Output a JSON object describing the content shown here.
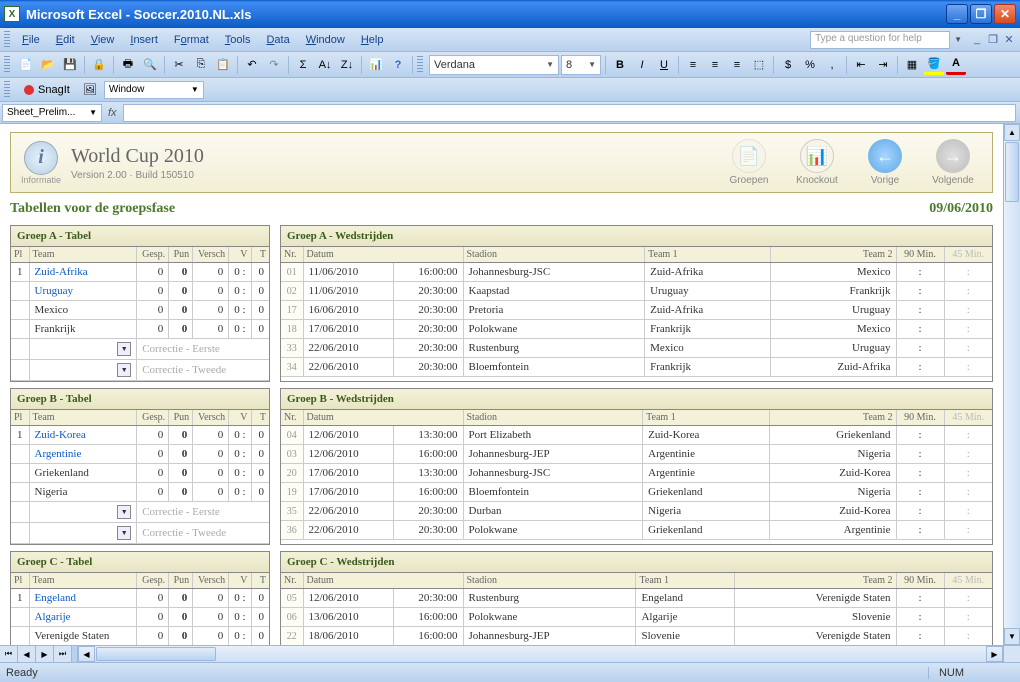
{
  "titlebar": {
    "app": "Microsoft Excel",
    "doc": "Soccer.2010.NL.xls"
  },
  "menu": {
    "file": "File",
    "edit": "Edit",
    "view": "View",
    "insert": "Insert",
    "format": "Format",
    "tools": "Tools",
    "data": "Data",
    "window": "Window",
    "help": "Help",
    "askbox": "Type a question for help"
  },
  "toolbar": {
    "font": "Verdana",
    "size": "8"
  },
  "snagit": {
    "label": "SnagIt",
    "window": "Window"
  },
  "namebox": "Sheet_Prelim...",
  "status": {
    "ready": "Ready",
    "num": "NUM"
  },
  "page": {
    "title": "World Cup 2010",
    "info_label": "Informatie",
    "version": "Version 2.00 · Build 150510",
    "nav": {
      "groepen": "Groepen",
      "knockout": "Knockout",
      "vorige": "Vorige",
      "volgende": "Volgende"
    },
    "subtitle": "Tabellen voor de groepsfase",
    "date": "09/06/2010",
    "table_cols": {
      "pl": "Pl",
      "team": "Team",
      "gesp": "Gesp.",
      "pun": "Pun",
      "versch": "Versch",
      "v": "V",
      "t": "T"
    },
    "match_cols": {
      "nr": "Nr.",
      "datum": "Datum",
      "stadion": "Stadion",
      "team1": "Team 1",
      "team2": "Team 2",
      "m90": "90 Min.",
      "m45": "45 Min."
    },
    "corrections": {
      "eerste": "Correctie - Eerste",
      "tweede": "Correctie - Tweede"
    },
    "groups": [
      {
        "label": "A",
        "tabel_title": "Groep A - Tabel",
        "wed_title": "Groep A - Wedstrijden",
        "standings": [
          {
            "pl": "1",
            "team": "Zuid-Afrika",
            "link": true,
            "gesp": "0",
            "pun": "0",
            "versch": "0",
            "v": "0",
            "t": "0"
          },
          {
            "pl": "",
            "team": "Uruguay",
            "link": true,
            "gesp": "0",
            "pun": "0",
            "versch": "0",
            "v": "0",
            "t": "0"
          },
          {
            "pl": "",
            "team": "Mexico",
            "link": false,
            "gesp": "0",
            "pun": "0",
            "versch": "0",
            "v": "0",
            "t": "0"
          },
          {
            "pl": "",
            "team": "Frankrijk",
            "link": false,
            "gesp": "0",
            "pun": "0",
            "versch": "0",
            "v": "0",
            "t": "0"
          }
        ],
        "matches": [
          {
            "nr": "01",
            "datum": "11/06/2010",
            "tijd": "16:00:00",
            "stadion": "Johannesburg-JSC",
            "team1": "Zuid-Afrika",
            "team2": "Mexico",
            "m90": ":",
            "m45": ":"
          },
          {
            "nr": "02",
            "datum": "11/06/2010",
            "tijd": "20:30:00",
            "stadion": "Kaapstad",
            "team1": "Uruguay",
            "team2": "Frankrijk",
            "m90": ":",
            "m45": ":"
          },
          {
            "nr": "17",
            "datum": "16/06/2010",
            "tijd": "20:30:00",
            "stadion": "Pretoria",
            "team1": "Zuid-Afrika",
            "team2": "Uruguay",
            "m90": ":",
            "m45": ":"
          },
          {
            "nr": "18",
            "datum": "17/06/2010",
            "tijd": "20:30:00",
            "stadion": "Polokwane",
            "team1": "Frankrijk",
            "team2": "Mexico",
            "m90": ":",
            "m45": ":"
          },
          {
            "nr": "33",
            "datum": "22/06/2010",
            "tijd": "20:30:00",
            "stadion": "Rustenburg",
            "team1": "Mexico",
            "team2": "Uruguay",
            "m90": ":",
            "m45": ":"
          },
          {
            "nr": "34",
            "datum": "22/06/2010",
            "tijd": "20:30:00",
            "stadion": "Bloemfontein",
            "team1": "Frankrijk",
            "team2": "Zuid-Afrika",
            "m90": ":",
            "m45": ":"
          }
        ]
      },
      {
        "label": "B",
        "tabel_title": "Groep B - Tabel",
        "wed_title": "Groep B - Wedstrijden",
        "standings": [
          {
            "pl": "1",
            "team": "Zuid-Korea",
            "link": true,
            "gesp": "0",
            "pun": "0",
            "versch": "0",
            "v": "0",
            "t": "0"
          },
          {
            "pl": "",
            "team": "Argentinie",
            "link": true,
            "gesp": "0",
            "pun": "0",
            "versch": "0",
            "v": "0",
            "t": "0"
          },
          {
            "pl": "",
            "team": "Griekenland",
            "link": false,
            "gesp": "0",
            "pun": "0",
            "versch": "0",
            "v": "0",
            "t": "0"
          },
          {
            "pl": "",
            "team": "Nigeria",
            "link": false,
            "gesp": "0",
            "pun": "0",
            "versch": "0",
            "v": "0",
            "t": "0"
          }
        ],
        "matches": [
          {
            "nr": "04",
            "datum": "12/06/2010",
            "tijd": "13:30:00",
            "stadion": "Port Elizabeth",
            "team1": "Zuid-Korea",
            "team2": "Griekenland",
            "m90": ":",
            "m45": ":"
          },
          {
            "nr": "03",
            "datum": "12/06/2010",
            "tijd": "16:00:00",
            "stadion": "Johannesburg-JEP",
            "team1": "Argentinie",
            "team2": "Nigeria",
            "m90": ":",
            "m45": ":"
          },
          {
            "nr": "20",
            "datum": "17/06/2010",
            "tijd": "13:30:00",
            "stadion": "Johannesburg-JSC",
            "team1": "Argentinie",
            "team2": "Zuid-Korea",
            "m90": ":",
            "m45": ":"
          },
          {
            "nr": "19",
            "datum": "17/06/2010",
            "tijd": "16:00:00",
            "stadion": "Bloemfontein",
            "team1": "Griekenland",
            "team2": "Nigeria",
            "m90": ":",
            "m45": ":"
          },
          {
            "nr": "35",
            "datum": "22/06/2010",
            "tijd": "20:30:00",
            "stadion": "Durban",
            "team1": "Nigeria",
            "team2": "Zuid-Korea",
            "m90": ":",
            "m45": ":"
          },
          {
            "nr": "36",
            "datum": "22/06/2010",
            "tijd": "20:30:00",
            "stadion": "Polokwane",
            "team1": "Griekenland",
            "team2": "Argentinie",
            "m90": ":",
            "m45": ":"
          }
        ]
      },
      {
        "label": "C",
        "tabel_title": "Groep C - Tabel",
        "wed_title": "Groep C - Wedstrijden",
        "standings": [
          {
            "pl": "1",
            "team": "Engeland",
            "link": true,
            "gesp": "0",
            "pun": "0",
            "versch": "0",
            "v": "0",
            "t": "0"
          },
          {
            "pl": "",
            "team": "Algarije",
            "link": true,
            "gesp": "0",
            "pun": "0",
            "versch": "0",
            "v": "0",
            "t": "0"
          },
          {
            "pl": "",
            "team": "Verenigde Staten",
            "link": false,
            "gesp": "0",
            "pun": "0",
            "versch": "0",
            "v": "0",
            "t": "0"
          }
        ],
        "matches": [
          {
            "nr": "05",
            "datum": "12/06/2010",
            "tijd": "20:30:00",
            "stadion": "Rustenburg",
            "team1": "Engeland",
            "team2": "Verenigde Staten",
            "m90": ":",
            "m45": ":"
          },
          {
            "nr": "06",
            "datum": "13/06/2010",
            "tijd": "16:00:00",
            "stadion": "Polokwane",
            "team1": "Algarije",
            "team2": "Slovenie",
            "m90": ":",
            "m45": ":"
          },
          {
            "nr": "22",
            "datum": "18/06/2010",
            "tijd": "16:00:00",
            "stadion": "Johannesburg-JEP",
            "team1": "Slovenie",
            "team2": "Verenigde Staten",
            "m90": ":",
            "m45": ":"
          }
        ],
        "partial": true
      }
    ]
  }
}
